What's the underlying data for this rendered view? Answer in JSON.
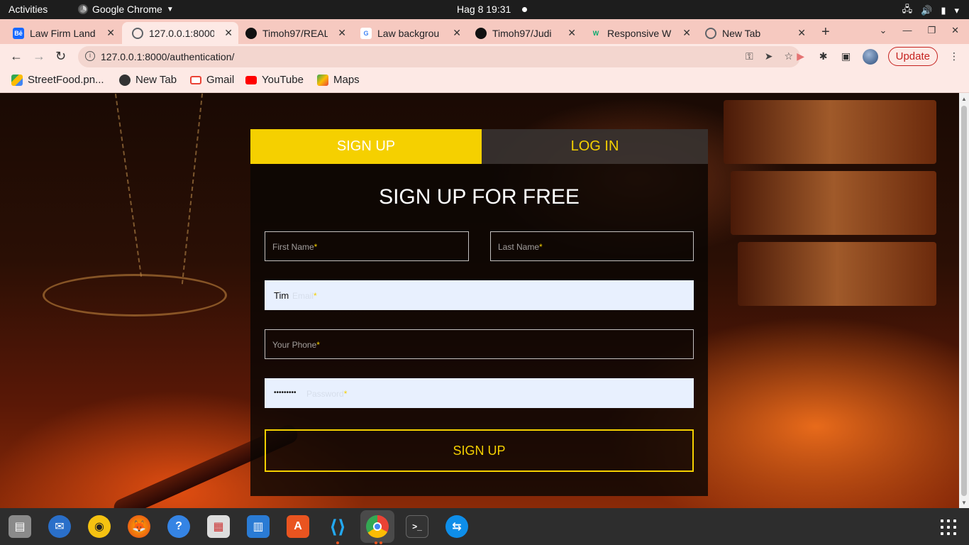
{
  "topbar": {
    "activities": "Activities",
    "app_name": "Google Chrome",
    "clock": "Hag 8  19:31"
  },
  "tabs": [
    {
      "title": "Law Firm Land",
      "favicon": "behance-icon",
      "color": "#1769ff",
      "glyph": "Bē"
    },
    {
      "title": "127.0.0.1:8000/",
      "favicon": "globe-icon",
      "color": "#5f6368",
      "glyph": ""
    },
    {
      "title": "Timoh97/REAL",
      "favicon": "github-icon",
      "color": "#111111",
      "glyph": ""
    },
    {
      "title": "Law backgrou",
      "favicon": "google-icon",
      "color": "#ffffff",
      "glyph": "G"
    },
    {
      "title": "Timoh97/Judi",
      "favicon": "github-icon",
      "color": "#111111",
      "glyph": ""
    },
    {
      "title": "Responsive W",
      "favicon": "w3-icon",
      "color": "#04aa6d",
      "glyph": "W"
    },
    {
      "title": "New Tab",
      "favicon": "chrome-icon",
      "color": "#5f6368",
      "glyph": ""
    }
  ],
  "address": {
    "url": "127.0.0.1:8000/authentication/"
  },
  "toolbar": {
    "update_label": "Update"
  },
  "bookmarks": [
    {
      "label": "StreetFood.pn...",
      "icon": "drive-icon",
      "color": "#34a853"
    },
    {
      "label": "New Tab",
      "icon": "globe-icon",
      "color": "#333333"
    },
    {
      "label": "Gmail",
      "icon": "gmail-icon",
      "color": "#ea4335"
    },
    {
      "label": "YouTube",
      "icon": "youtube-icon",
      "color": "#ff0000"
    },
    {
      "label": "Maps",
      "icon": "maps-icon",
      "color": "#34a853"
    }
  ],
  "auth": {
    "tab_signup": "SIGN UP",
    "tab_login": "LOG IN",
    "heading": "SIGN UP FOR FREE",
    "first_name_placeholder": "First Name",
    "last_name_placeholder": "Last Name",
    "email_placeholder": "Email",
    "email_value": "Tim",
    "phone_placeholder": "Your Phone",
    "password_placeholder": "Password",
    "password_value": "•••••••••",
    "required_mark": "*",
    "submit_label": "SIGN UP"
  },
  "colors": {
    "accent": "#f5d000",
    "tabstrip": "#f6c9c0",
    "update": "#c5221f"
  },
  "dock": [
    "files-icon",
    "thunderbird-icon",
    "rhythmbox-icon",
    "firefox-icon",
    "help-icon",
    "screenshot-icon",
    "writer-icon",
    "software-center-icon",
    "vscode-icon",
    "chrome-icon",
    "terminal-icon",
    "teamviewer-icon"
  ]
}
